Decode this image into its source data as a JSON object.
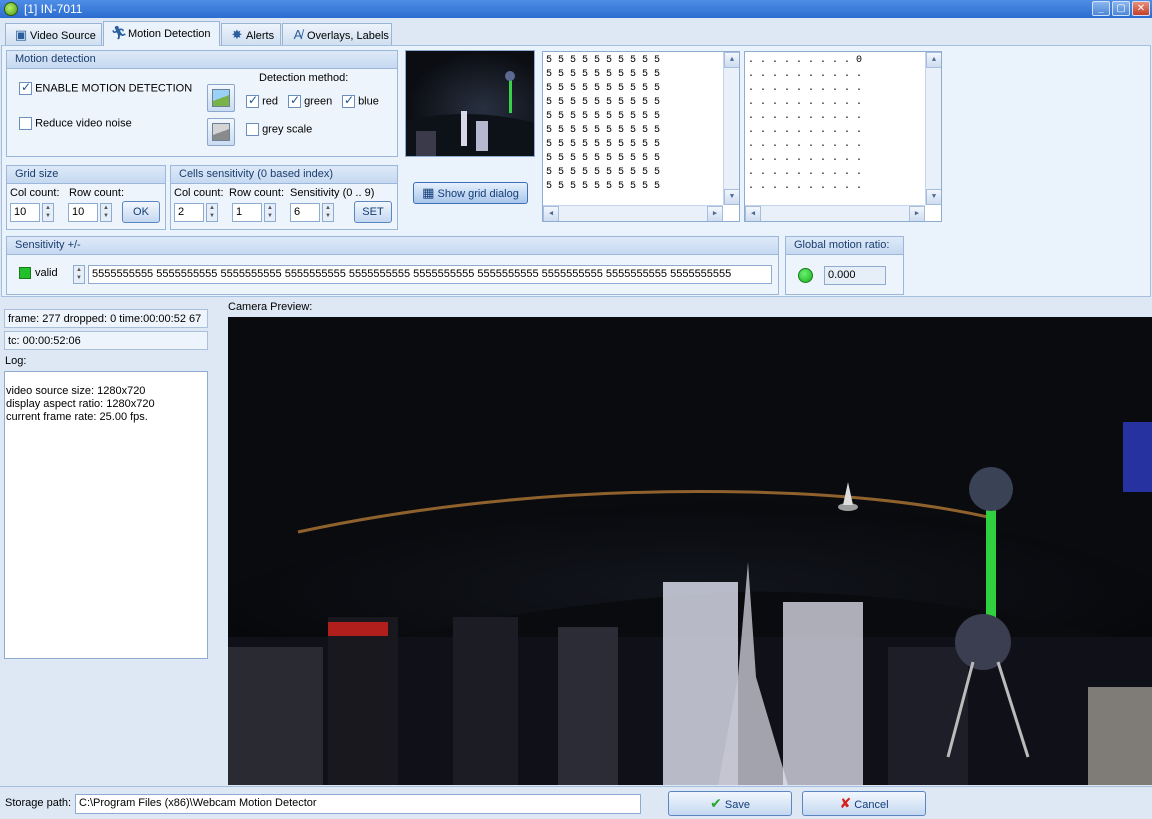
{
  "window": {
    "title": "[1] IN-7011",
    "minimize": "_",
    "maximize": "▢",
    "close": "✕"
  },
  "tabs": [
    {
      "label": "Video Source",
      "icon": "camera-icon"
    },
    {
      "label": "Motion Detection",
      "icon": "running-man-icon"
    },
    {
      "label": "Alerts",
      "icon": "alert-icon"
    },
    {
      "label": "Overlays, Labels",
      "icon": "text-overlay-icon"
    }
  ],
  "motion": {
    "title": "Motion detection",
    "enable_label": "ENABLE MOTION DETECTION",
    "enable_checked": true,
    "noise_label": "Reduce video noise",
    "noise_checked": false,
    "method_title": "Detection method:",
    "red": "red",
    "green": "green",
    "blue": "blue",
    "grey": "grey scale"
  },
  "grid_size": {
    "title": "Grid size",
    "col_label": "Col count:",
    "row_label": "Row count:",
    "col_value": "10",
    "row_value": "10",
    "ok": "OK"
  },
  "cells": {
    "title": "Cells sensitivity  (0 based index)",
    "col_label": "Col count:",
    "row_label": "Row count:",
    "sens_label": "Sensitivity (0 .. 9)",
    "col_value": "2",
    "row_value": "1",
    "sens_value": "6",
    "set": "SET"
  },
  "show_grid_button": "Show grid dialog",
  "grid_text_1": "5 5 5 5 5 5 5 5 5 5\n5 5 5 5 5 5 5 5 5 5\n5 5 5 5 5 5 5 5 5 5\n5 5 5 5 5 5 5 5 5 5\n5 5 5 5 5 5 5 5 5 5\n5 5 5 5 5 5 5 5 5 5\n5 5 5 5 5 5 5 5 5 5\n5 5 5 5 5 5 5 5 5 5\n5 5 5 5 5 5 5 5 5 5\n5 5 5 5 5 5 5 5 5 5",
  "grid_text_2": ". . . . . . . . . 0\n. . . . . . . . . .\n. . . . . . . . . .\n. . . . . . . . . .\n. . . . . . . . . .\n. . . . . . . . . .\n. . . . . . . . . .\n. . . . . . . . . .\n. . . . . . . . . .\n. . . . . . . . . .",
  "sensitivity": {
    "title": "Sensitivity +/-",
    "valid": "valid",
    "value": "5555555555 5555555555 5555555555 5555555555 5555555555 5555555555 5555555555 5555555555 5555555555 5555555555"
  },
  "global": {
    "title": "Global motion ratio:",
    "value": "0.000"
  },
  "status": {
    "frame": "frame: 277 dropped: 0 time:00:00:52 67",
    "tc": "tc: 00:00:52:06",
    "log_label": "Log:",
    "log_lines": [
      "video source size: 1280x720",
      "display aspect ratio: 1280x720",
      "current frame rate: 25.00 fps."
    ]
  },
  "preview_label": "Camera Preview:",
  "storage": {
    "label": "Storage path:",
    "value": "C:\\Program Files (x86)\\Webcam Motion Detector"
  },
  "save": "Save",
  "cancel": "Cancel",
  "colors": {
    "accent": "#2b6cd0",
    "valid_green": "#22c02a",
    "panel": "#eaf2fb"
  }
}
